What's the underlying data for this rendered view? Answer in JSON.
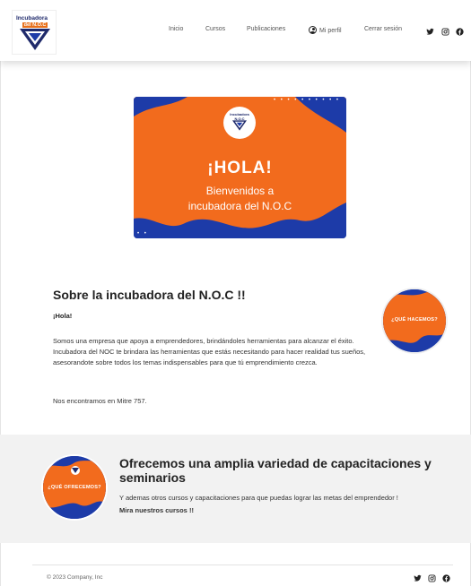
{
  "brand": {
    "logo_line1": "Incubadora",
    "logo_line2": "del N.O.C"
  },
  "nav": {
    "inicio": "Inicio",
    "cursos": "Cursos",
    "publicaciones": "Publicaciones",
    "perfil": "Mi perfil",
    "cerrar": "Cerrar sesión"
  },
  "social": [
    "twitter-icon",
    "instagram-icon",
    "facebook-icon"
  ],
  "hero": {
    "badge_line1": "Incubadora",
    "badge_line2": "N.O.C",
    "title": "¡HOLA!",
    "subtitle_line1": "Bienvenidos a",
    "subtitle_line2": "incubadora del N.O.C"
  },
  "about": {
    "title": "Sobre la incubadora del N.O.C !!",
    "greeting": "¡Hola!",
    "text": "Somos una empresa que apoya a emprendedores, brindándoles herramientas para alcanzar el éxito. Incubadora del NOC te brindara las herramientas que estás necesitando para hacer realidad tus sueños, asesorandote sobre todos los temas indispensables para que tú emprendimiento crezca.",
    "location": "Nos encontramos en Mitre 757.",
    "circle_label": "¿QUÉ HACEMOS?"
  },
  "offer": {
    "title": "Ofrecemos una amplia variedad de capacitaciones y seminarios",
    "text": "Y ademas otros cursos y capacitaciones para que puedas lograr las metas del emprendedor ! ",
    "link": "Mira nuestros cursos !!",
    "circle_label": "¿QUÉ OFRECEMOS?"
  },
  "footer": {
    "copyright": "© 2023 Company, Inc"
  },
  "colors": {
    "orange": "#f26b1d",
    "blue": "#1d3ba8",
    "navy": "#1f2a6b"
  }
}
